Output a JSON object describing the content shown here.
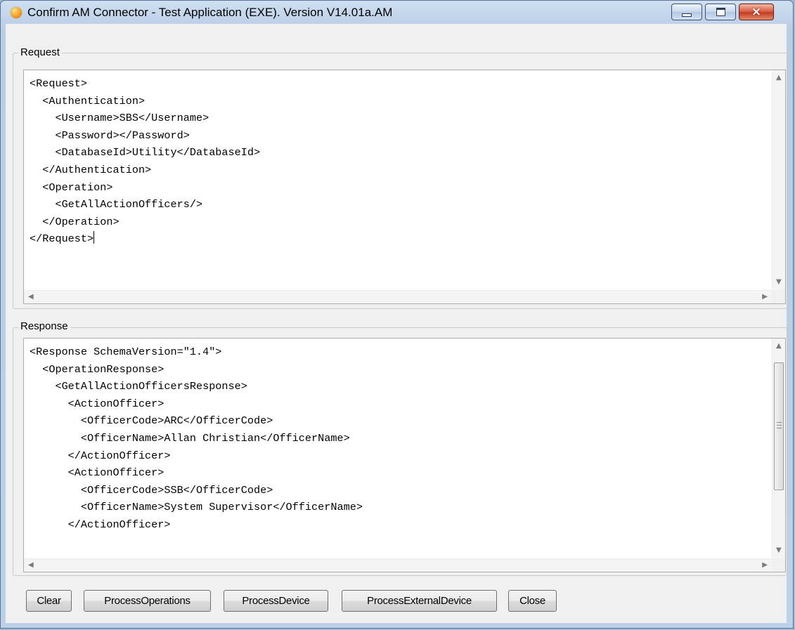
{
  "window": {
    "title": "Confirm AM Connector - Test Application (EXE). Version V14.01a.AM",
    "controls": {
      "minimize": "minimize",
      "maximize": "maximize",
      "close": "×"
    }
  },
  "request": {
    "label": "Request",
    "lines": [
      "<Request>",
      "  <Authentication>",
      "    <Username>SBS</Username>",
      "    <Password></Password>",
      "    <DatabaseId>Utility</DatabaseId>",
      "  </Authentication>",
      "  <Operation>",
      "    <GetAllActionOfficers/>",
      "  </Operation>",
      "</Request>"
    ]
  },
  "response": {
    "label": "Response",
    "lines": [
      "<Response SchemaVersion=\"1.4\">",
      "  <OperationResponse>",
      "    <GetAllActionOfficersResponse>",
      "      <ActionOfficer>",
      "        <OfficerCode>ARC</OfficerCode>",
      "        <OfficerName>Allan Christian</OfficerName>",
      "      </ActionOfficer>",
      "      <ActionOfficer>",
      "        <OfficerCode>SSB</OfficerCode>",
      "        <OfficerName>System Supervisor</OfficerName>",
      "      </ActionOfficer>"
    ]
  },
  "buttons": {
    "clear": "Clear",
    "process_operations": "ProcessOperations",
    "process_device": "ProcessDevice",
    "process_external_device": "ProcessExternalDevice",
    "close": "Close"
  },
  "icons": {
    "app": "orange-sphere-icon",
    "scroll_up": "▲",
    "scroll_down": "▼",
    "scroll_left": "◀",
    "scroll_right": "▶"
  }
}
